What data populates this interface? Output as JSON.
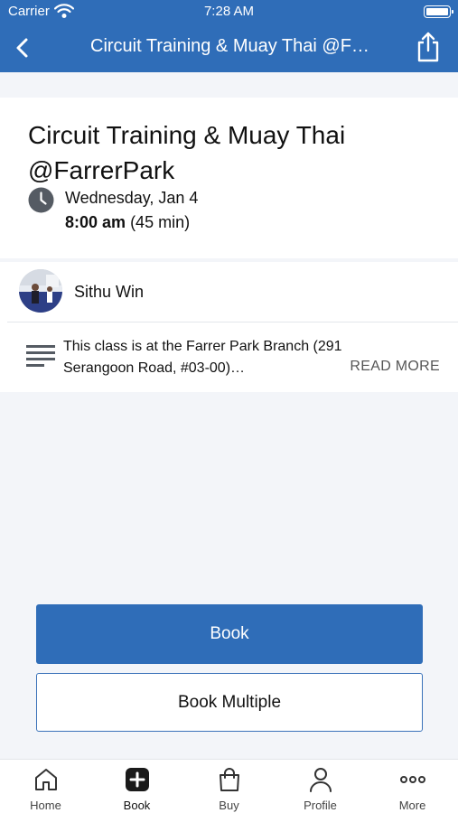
{
  "status_bar": {
    "carrier": "Carrier",
    "time": "7:28 AM"
  },
  "header": {
    "title": "Circuit Training & Muay Thai @FarrerPark"
  },
  "class_info": {
    "title": "Circuit Training & Muay Thai @FarrerPark",
    "date": "Wednesday, Jan 4",
    "time": "8:00 am",
    "duration": "(45 min)"
  },
  "instructor": {
    "name": "Sithu Win"
  },
  "description": {
    "text": "This class is at the Farrer Park Branch (291 Serangoon Road, #03-00)…",
    "read_more_label": "READ MORE"
  },
  "actions": {
    "book_label": "Book",
    "book_multiple_label": "Book Multiple"
  },
  "tabs": [
    {
      "label": "Home",
      "icon": "home-icon"
    },
    {
      "label": "Book",
      "icon": "plus-icon"
    },
    {
      "label": "Buy",
      "icon": "bag-icon"
    },
    {
      "label": "Profile",
      "icon": "person-icon"
    },
    {
      "label": "More",
      "icon": "more-icon"
    }
  ],
  "colors": {
    "accent": "#2f6db8",
    "background": "#f3f5f9"
  }
}
